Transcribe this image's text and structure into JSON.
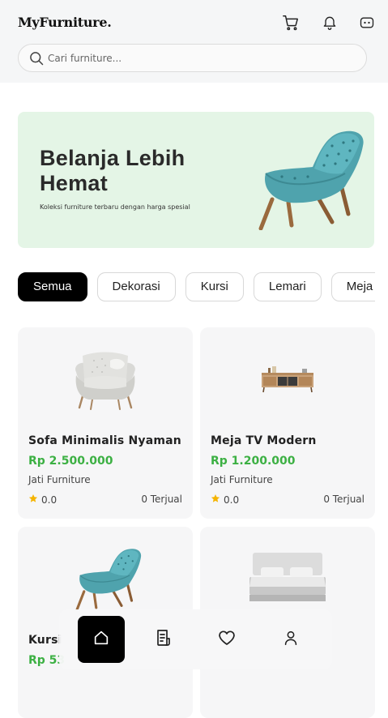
{
  "header": {
    "brand": "MyFurniture.",
    "search_placeholder": "Cari furniture..."
  },
  "banner": {
    "title": "Belanja Lebih Hemat",
    "subtitle": "Koleksi furniture terbaru dengan harga spesial"
  },
  "categories": [
    {
      "label": "Semua",
      "active": true
    },
    {
      "label": "Dekorasi",
      "active": false
    },
    {
      "label": "Kursi",
      "active": false
    },
    {
      "label": "Lemari",
      "active": false
    },
    {
      "label": "Meja",
      "active": false
    }
  ],
  "products": [
    {
      "name": "Sofa Minimalis Nyaman",
      "price": "Rp 2.500.000",
      "store": "Jati Furniture",
      "rating": "0.0",
      "sold": "0 Terjual",
      "image": "sofa"
    },
    {
      "name": "Meja TV Modern",
      "price": "Rp 1.200.000",
      "store": "Jati Furniture",
      "rating": "0.0",
      "sold": "0 Terjual",
      "image": "tv-stand"
    },
    {
      "name": "Kursi",
      "price": "Rp 53",
      "store": "",
      "rating": "",
      "sold": "",
      "image": "lounge-chair"
    },
    {
      "name": "",
      "price": "",
      "store": "",
      "rating": "",
      "sold": "",
      "image": "bed"
    }
  ],
  "nav": [
    {
      "icon": "home-icon",
      "active": true
    },
    {
      "icon": "orders-icon",
      "active": false
    },
    {
      "icon": "heart-icon",
      "active": false
    },
    {
      "icon": "profile-icon",
      "active": false
    }
  ],
  "colors": {
    "accent_green": "#3cb043",
    "banner_bg": "#e4f5e6",
    "chip_active": "#000000"
  }
}
